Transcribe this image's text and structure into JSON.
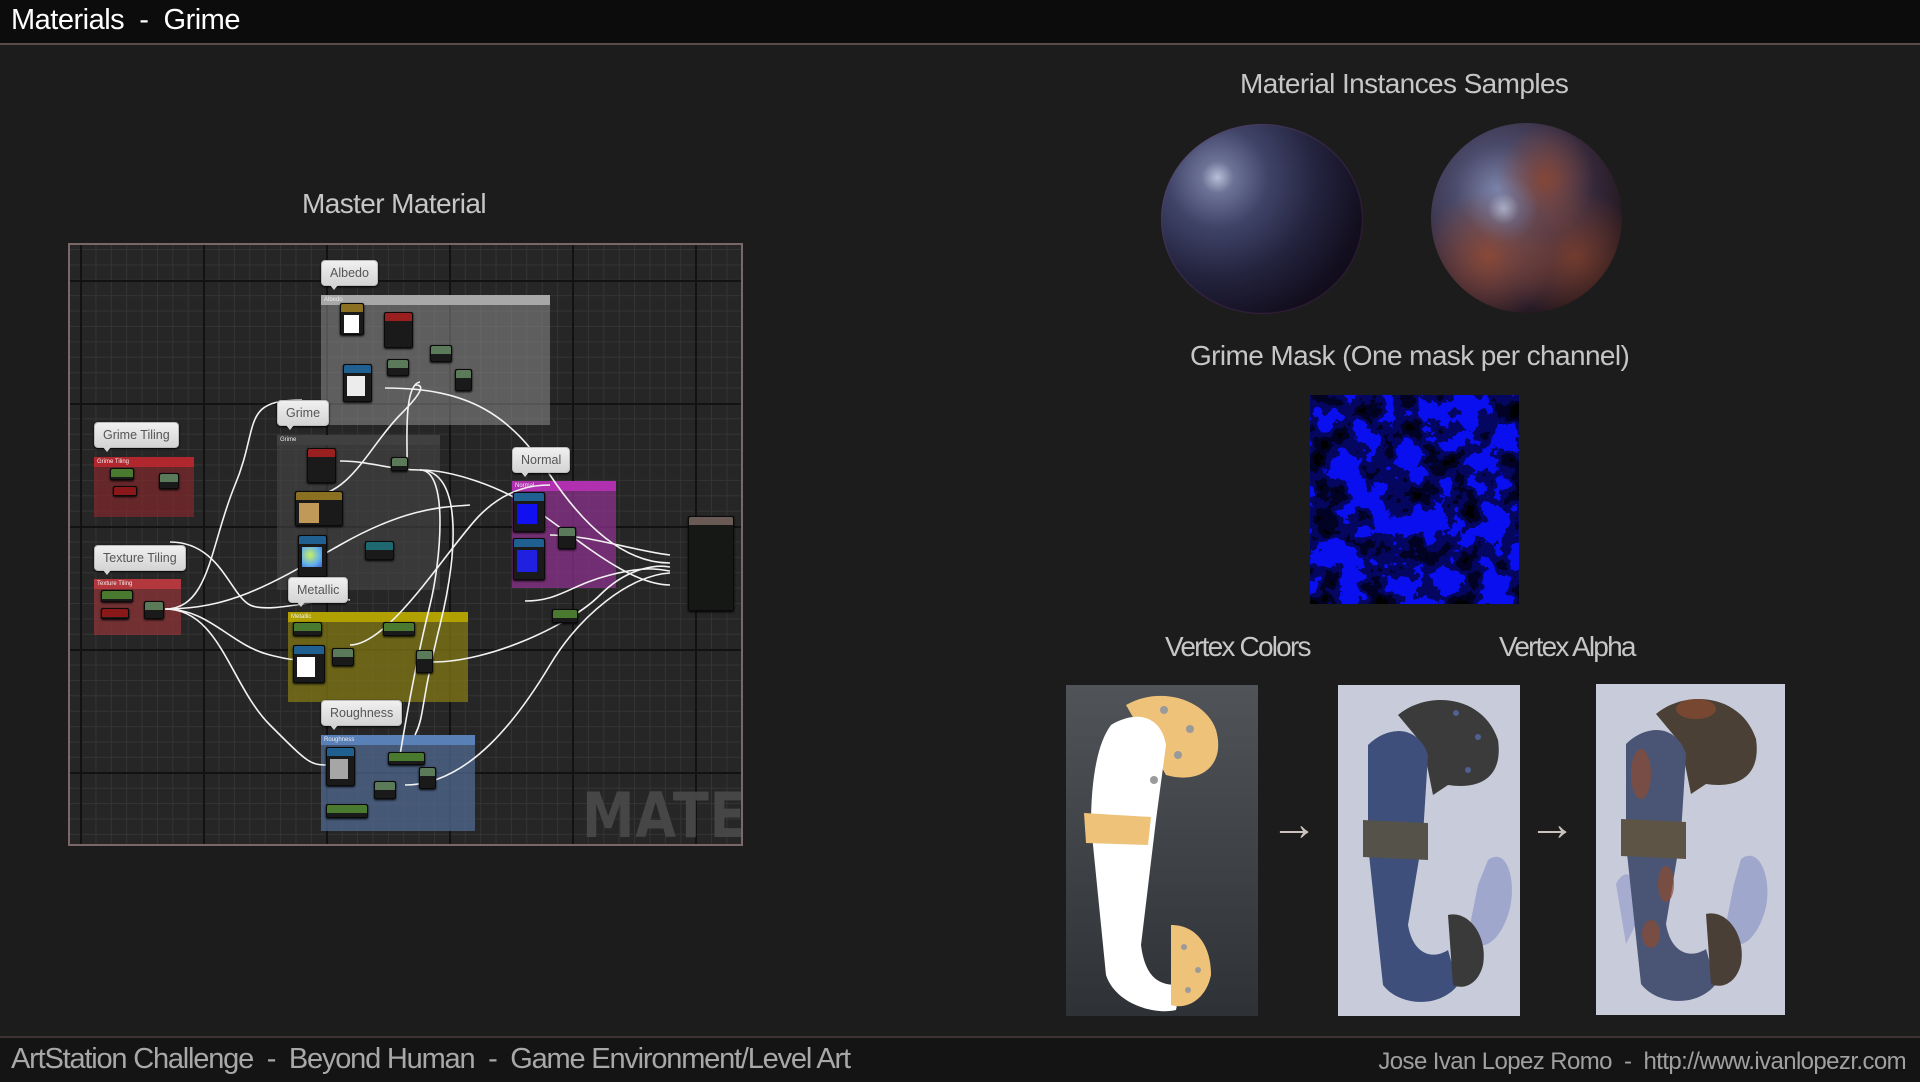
{
  "header": {
    "title": "Materials  -  Grime"
  },
  "master_material": {
    "title": "Master Material",
    "watermark": "MATERIAL",
    "comments": [
      {
        "label": "Albedo",
        "group_title": "Albedo",
        "color": "#8a8a8a"
      },
      {
        "label": "Grime",
        "group_title": "Grime",
        "color": "#4a4a4a"
      },
      {
        "label": "Grime Tiling",
        "group_title": "Grime Tiling",
        "color": "#8b2c30"
      },
      {
        "label": "Texture Tiling",
        "group_title": "Texture Tiling",
        "color": "#8e3438"
      },
      {
        "label": "Normal",
        "group_title": "Normal",
        "color": "#8c2f8c"
      },
      {
        "label": "Metallic",
        "group_title": "Metallic",
        "color": "#857a10"
      },
      {
        "label": "Roughness",
        "group_title": "Roughness",
        "color": "#4a5e80"
      }
    ]
  },
  "samples": {
    "title": "Material Instances Samples"
  },
  "grime_mask": {
    "title": "Grime Mask (One mask per channel)"
  },
  "vertex": {
    "colors_title": "Vertex Colors",
    "alpha_title": "Vertex Alpha",
    "arrow_glyph": "→"
  },
  "footer": {
    "left": "ArtStation Challenge  -  Beyond Human  -  Game Environment/Level Art",
    "right": "Jose Ivan Lopez Romo  -  http://www.ivanlopezr.com"
  }
}
